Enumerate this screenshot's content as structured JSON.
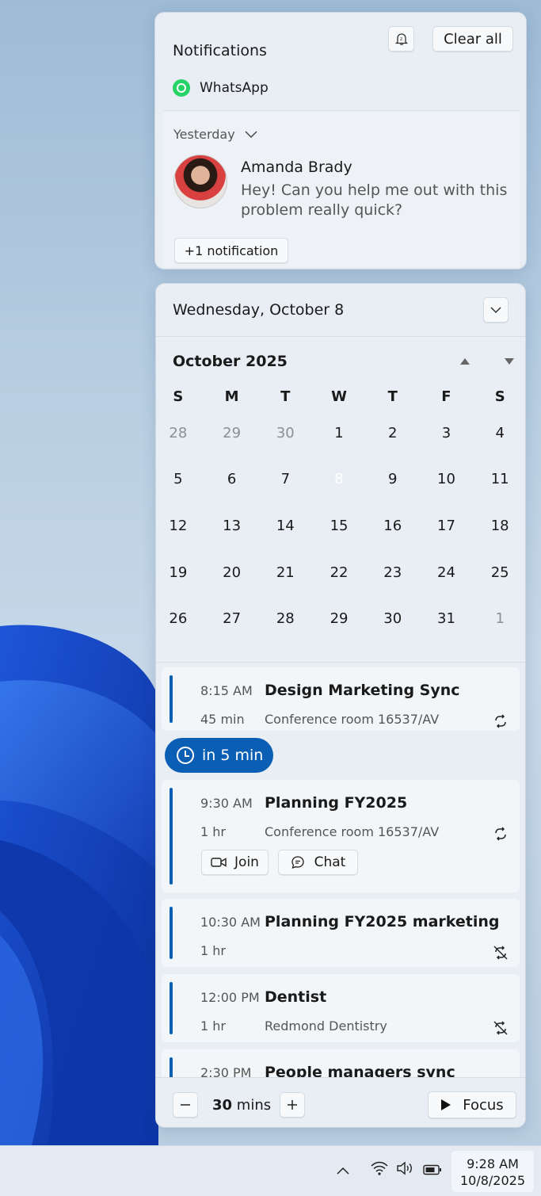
{
  "notifications": {
    "title": "Notifications",
    "clear_all": "Clear all",
    "app_name": "WhatsApp",
    "group_label": "Yesterday",
    "sender": "Amanda Brady",
    "message": "Hey! Can you help me out with this problem really quick?",
    "more_label": "+1 notification"
  },
  "calendar": {
    "date_title": "Wednesday, October 8",
    "month_title": "October 2025",
    "weekdays": [
      "S",
      "M",
      "T",
      "W",
      "T",
      "F",
      "S"
    ],
    "weeks": [
      [
        "28",
        "29",
        "30",
        "1",
        "2",
        "3",
        "4"
      ],
      [
        "5",
        "6",
        "7",
        "8",
        "9",
        "10",
        "11"
      ],
      [
        "12",
        "13",
        "14",
        "15",
        "16",
        "17",
        "18"
      ],
      [
        "19",
        "20",
        "21",
        "22",
        "23",
        "24",
        "25"
      ],
      [
        "26",
        "27",
        "28",
        "29",
        "30",
        "31",
        "1"
      ]
    ],
    "today": "8"
  },
  "agenda": {
    "events": [
      {
        "time": "8:15 AM",
        "title": "Design Marketing Sync",
        "duration": "45 min",
        "location": "Conference room 16537/AV",
        "icon": "recurring-icon"
      },
      {
        "time": "9:30 AM",
        "title": "Planning FY2025",
        "duration": "1 hr",
        "location": "Conference room 16537/AV",
        "icon": "recurring-icon",
        "join": "Join",
        "chat": "Chat"
      },
      {
        "time": "10:30 AM",
        "title": "Planning FY2025 marketing",
        "duration": "1 hr",
        "location": "",
        "icon": "recurring-off-icon"
      },
      {
        "time": "12:00 PM",
        "title": "Dentist",
        "duration": "1 hr",
        "location": "Redmond Dentistry",
        "icon": "recurring-off-icon"
      },
      {
        "time": "2:30 PM",
        "title": "People managers sync",
        "duration": "",
        "location": "",
        "icon": ""
      }
    ],
    "upcoming_label": "in 5 min"
  },
  "focus": {
    "duration_value": "30",
    "duration_unit": "mins",
    "focus_label": "Focus"
  },
  "taskbar": {
    "time": "9:28 AM",
    "date": "10/8/2025"
  },
  "colors": {
    "accent": "#0a5fb4",
    "whatsapp": "#25d366"
  }
}
